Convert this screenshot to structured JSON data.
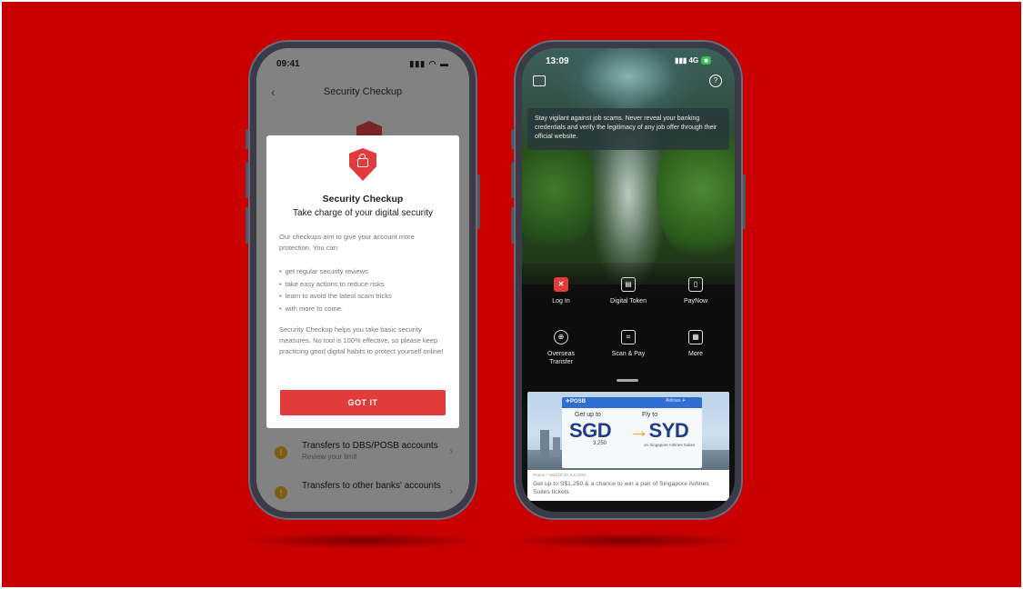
{
  "colors": {
    "background": "#c80000",
    "accent_red": "#e23b3b",
    "banner_blue": "#1f3d8a",
    "warning_yellow": "#e8a81a"
  },
  "left_phone": {
    "status_time": "09:41",
    "status_icons": "▮▮▮ ◠ ▬",
    "back_icon": "chevron-left-icon",
    "back_glyph": "‹",
    "header_title": "Security Checkup",
    "modal": {
      "icon": "shield-lock-icon",
      "title": "Security Checkup",
      "subtitle": "Take charge of your digital security",
      "intro": "Our checkups aim to give your account more protection. You can:",
      "bullets": [
        "get regular security reviews",
        "take easy actions to reduce risks",
        "learn to avoid the latest scam tricks",
        "with more to come."
      ],
      "footer": "Security Checkup helps you take basic security measures. No tool is 100% effective, so please keep practicing good digital habits to protect yourself online!",
      "button_label": "GOT IT"
    },
    "list": [
      {
        "icon": "warning-icon",
        "glyph": "!",
        "title": "Transfers to DBS/POSB accounts",
        "subtitle": "Review your limit",
        "chevron": "›"
      },
      {
        "icon": "warning-icon",
        "glyph": "!",
        "title": "Transfers to other banks' accounts",
        "subtitle": "",
        "chevron": "›"
      }
    ]
  },
  "right_phone": {
    "status_time": "13:09",
    "status_network": "▮▮▮ 4G",
    "status_battery": "■",
    "help_glyph": "?",
    "notice": "Stay vigilant against job scams. Never reveal your banking credentials and verify the legitimacy of any job offer through their official website.",
    "quick_actions": [
      {
        "label": "Log In",
        "icon": "login-icon",
        "glyph": "✕"
      },
      {
        "label": "Digital Token",
        "icon": "token-icon",
        "glyph": "▤"
      },
      {
        "label": "PayNow",
        "icon": "paynow-icon",
        "glyph": "▯"
      },
      {
        "label": "Overseas Transfer",
        "icon": "globe-icon",
        "glyph": "⊕"
      },
      {
        "label": "Scan & Pay",
        "icon": "scan-icon",
        "glyph": "⌗"
      },
      {
        "label": "More",
        "icon": "grid-icon",
        "glyph": "▦"
      }
    ],
    "banner": {
      "logo": "✈POSB",
      "partner": "Airlines ✈",
      "left_line": "Get up to",
      "left_big": "SGD",
      "left_amount": "3,250",
      "right_line": "Fly to",
      "right_arrow": "→",
      "right_big": "SYD",
      "airline_note": "on Singapore Airlines Suites",
      "meta": "Promo • Valid till 30 Jun 2024",
      "caption": "Get up to S$1,250 & a chance to win a pair of Singapore Airlines Suites tickets"
    }
  }
}
